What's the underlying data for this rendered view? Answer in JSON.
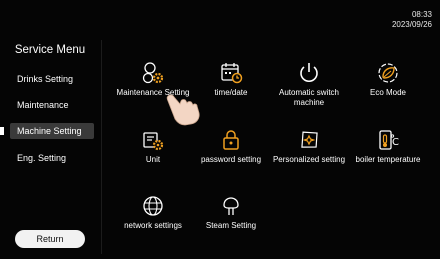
{
  "status": {
    "time": "08:33",
    "date": "2023/09/26"
  },
  "sidebar": {
    "title": "Service Menu",
    "items": [
      {
        "label": "Drinks Setting",
        "active": false
      },
      {
        "label": "Maintenance",
        "active": false
      },
      {
        "label": "Machine Setting",
        "active": true
      },
      {
        "label": "Eng. Setting",
        "active": false
      }
    ],
    "return_label": "Return"
  },
  "grid": {
    "tiles": [
      {
        "label": "Maintenance Setting",
        "icon": "gears-icon"
      },
      {
        "label": "time/date",
        "icon": "calendar-clock-icon"
      },
      {
        "label": "Automatic switch machine",
        "icon": "power-icon"
      },
      {
        "label": "Eco Mode",
        "icon": "leaf-icon"
      },
      {
        "label": "Unit",
        "icon": "unit-gear-icon"
      },
      {
        "label": "password setting",
        "icon": "lock-icon"
      },
      {
        "label": "Personalized setting",
        "icon": "sparkle-icon"
      },
      {
        "label": "boiler temperature",
        "icon": "thermometer-icon"
      },
      {
        "label": "network settings",
        "icon": "globe-icon"
      },
      {
        "label": "Steam Setting",
        "icon": "steam-icon"
      }
    ]
  },
  "colors": {
    "icon_accent": "#f0a020",
    "background": "#050505",
    "active_item": "#3a3a3a"
  }
}
